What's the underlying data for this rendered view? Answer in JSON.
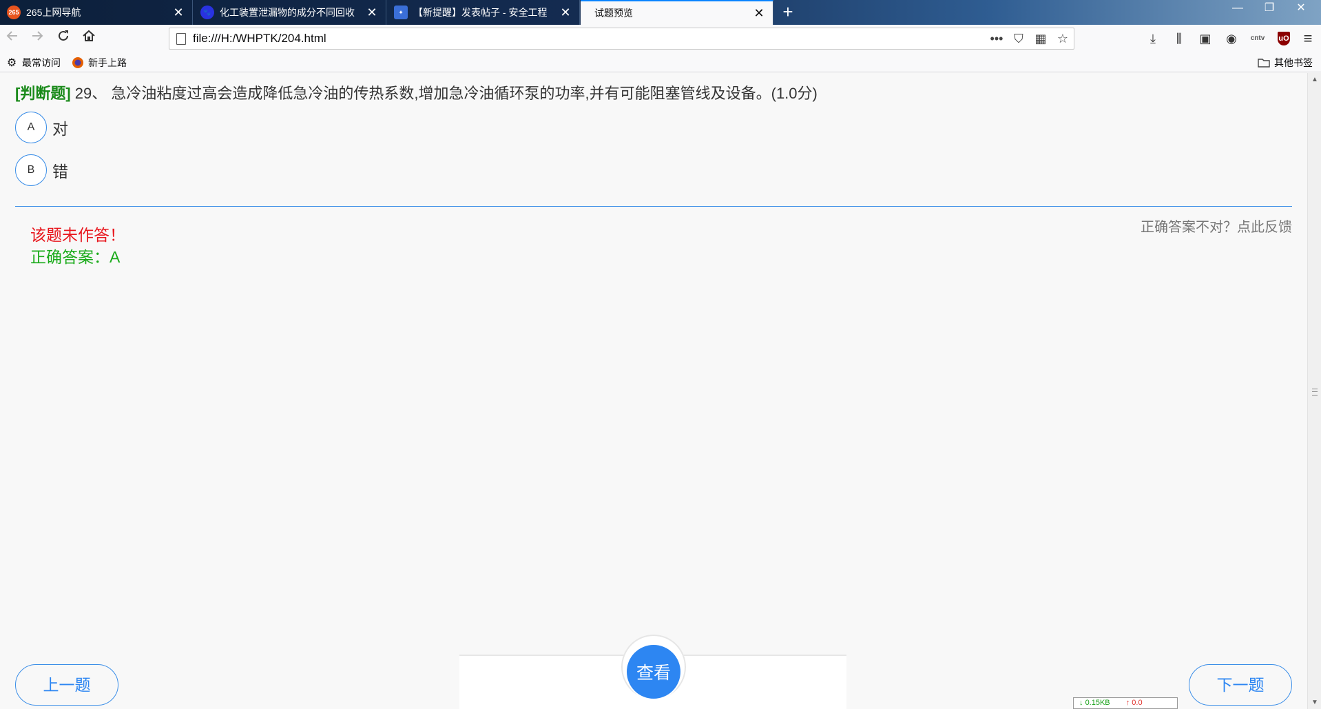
{
  "browser": {
    "tabs": [
      {
        "title": "265上网导航",
        "icon": "265-site-icon",
        "icon_color": "#e8541e",
        "icon_text": "265"
      },
      {
        "title": "化工装置泄漏物的成分不同回收",
        "icon": "baidu-paw-icon",
        "icon_color": "#2932e1",
        "icon_text": "🐾"
      },
      {
        "title": "【新提醒】发表帖子 - 安全工程",
        "icon": "forum-puzzle-icon",
        "icon_color": "#3a6fd8",
        "icon_text": "✦"
      },
      {
        "title": "试题预览",
        "icon": "",
        "active": true
      }
    ],
    "close_glyph": "✕",
    "new_tab_glyph": "+",
    "window_controls": {
      "minimize": "—",
      "restore": "❐",
      "close": "✕"
    },
    "url": "file:///H:/WHPTK/204.html",
    "url_icons": {
      "more": "•••",
      "pocket": "⛉",
      "qr": "▦",
      "star": "☆"
    },
    "toolbar_icons": {
      "download": "⤓",
      "library": "⫼",
      "sidebar": "▣",
      "account": "◉",
      "cntv": "cntv",
      "ublock": "uO",
      "menu": "≡"
    },
    "bookmarks": {
      "most_visited": "最常访问",
      "getting_started": "新手上路",
      "other": "其他书签"
    }
  },
  "question": {
    "type_label": "[判断题]",
    "number": "29、",
    "text": "急冷油粘度过高会造成降低急冷油的传热系数,增加急冷油循环泵的功率,并有可能阻塞管线及设备。(1.0分)",
    "options": [
      {
        "letter": "A",
        "text": "对"
      },
      {
        "letter": "B",
        "text": "错"
      }
    ]
  },
  "result": {
    "feedback_link": "正确答案不对？点此反馈",
    "unanswered": "该题未作答！",
    "correct_answer": "正确答案：A"
  },
  "buttons": {
    "prev": "上一题",
    "view": "查看",
    "next": "下一题"
  },
  "net_meter": {
    "down": "0.15KB",
    "up": "0.0"
  },
  "colors": {
    "accent": "#2d86f2",
    "question_type": "#1a8a1a",
    "error": "#e8161d",
    "success": "#1aab1a"
  }
}
